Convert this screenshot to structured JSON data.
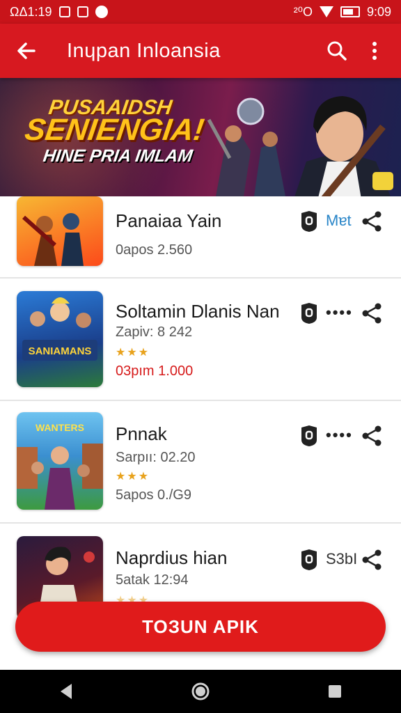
{
  "status": {
    "time_left": "ΩΔ1:19",
    "right_text": "²⁰O",
    "battery_label": "▭▭",
    "clock": "9:09"
  },
  "appbar": {
    "title": "Inɥpan Inloansia",
    "back_icon": "arrow-back-icon",
    "search_icon": "search-icon",
    "menu_icon": "more-vert-icon"
  },
  "banner": {
    "line1": "PUSAAIDSH",
    "line2": "SENIENGIA!",
    "line3": "HINE PRIA IMLAM"
  },
  "apps": [
    {
      "name": "Panaiaa Yain",
      "meta1": "0apos  2.560",
      "stars": "",
      "meta2": "",
      "tag": "Mɐt"
    },
    {
      "name": "Soltamin Dlanis Nan",
      "meta1": "Zapiv: 8 242",
      "stars": "★★★",
      "meta2": "03pım  1.000",
      "tag": "••••",
      "thumb_text": "SANIAMANS"
    },
    {
      "name": "Pnnak",
      "meta1": "Sarpıı: 02.20",
      "stars": "★★★",
      "meta2": "5apos  0./G9",
      "tag": "••••",
      "thumb_text": "WANTERS"
    },
    {
      "name": "Naprdius hian",
      "meta1": "5atak  12:94",
      "stars": "★★★",
      "meta2": "",
      "tag": "S3bI"
    }
  ],
  "fab": {
    "label": "TOЗUN APIK"
  },
  "colors": {
    "primary": "#d71920",
    "status": "#c8141a",
    "fab": "#e01b1b",
    "accent_text": "#2a86c8"
  }
}
